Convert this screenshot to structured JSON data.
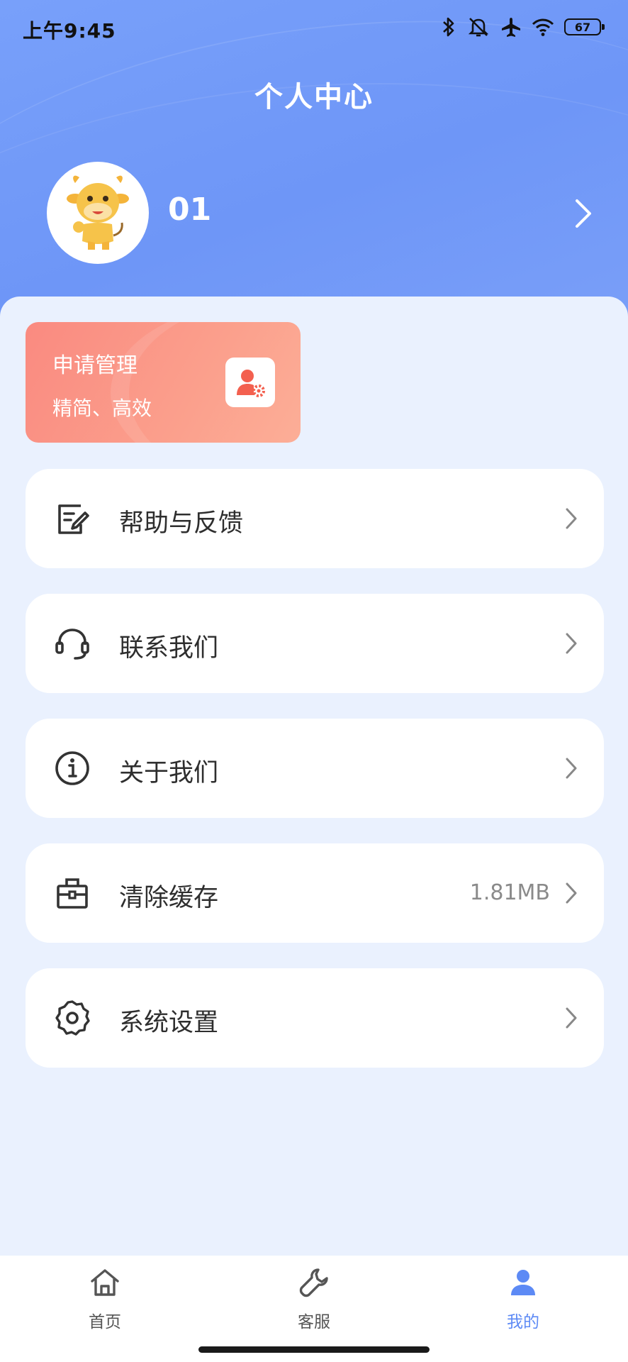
{
  "status_bar": {
    "time": "上午9:45",
    "battery": "67"
  },
  "page": {
    "title": "个人中心"
  },
  "profile": {
    "username": "01"
  },
  "apply_card": {
    "title": "申请管理",
    "subtitle": "精简、高效"
  },
  "menu": [
    {
      "label": "帮助与反馈",
      "icon": "feedback-icon",
      "value": ""
    },
    {
      "label": "联系我们",
      "icon": "headset-icon",
      "value": ""
    },
    {
      "label": "关于我们",
      "icon": "info-icon",
      "value": ""
    },
    {
      "label": "清除缓存",
      "icon": "toolbox-icon",
      "value": "1.81MB"
    },
    {
      "label": "系统设置",
      "icon": "gear-icon",
      "value": ""
    }
  ],
  "tabbar": {
    "items": [
      {
        "label": "首页",
        "icon": "home-icon",
        "active": false
      },
      {
        "label": "客服",
        "icon": "wrench-icon",
        "active": false
      },
      {
        "label": "我的",
        "icon": "user-icon",
        "active": true
      }
    ]
  },
  "colors": {
    "header_blue": "#6e96f7",
    "accent_blue": "#5d8af5",
    "card_coral": "#fa8a80",
    "background": "#eaf1fe"
  }
}
